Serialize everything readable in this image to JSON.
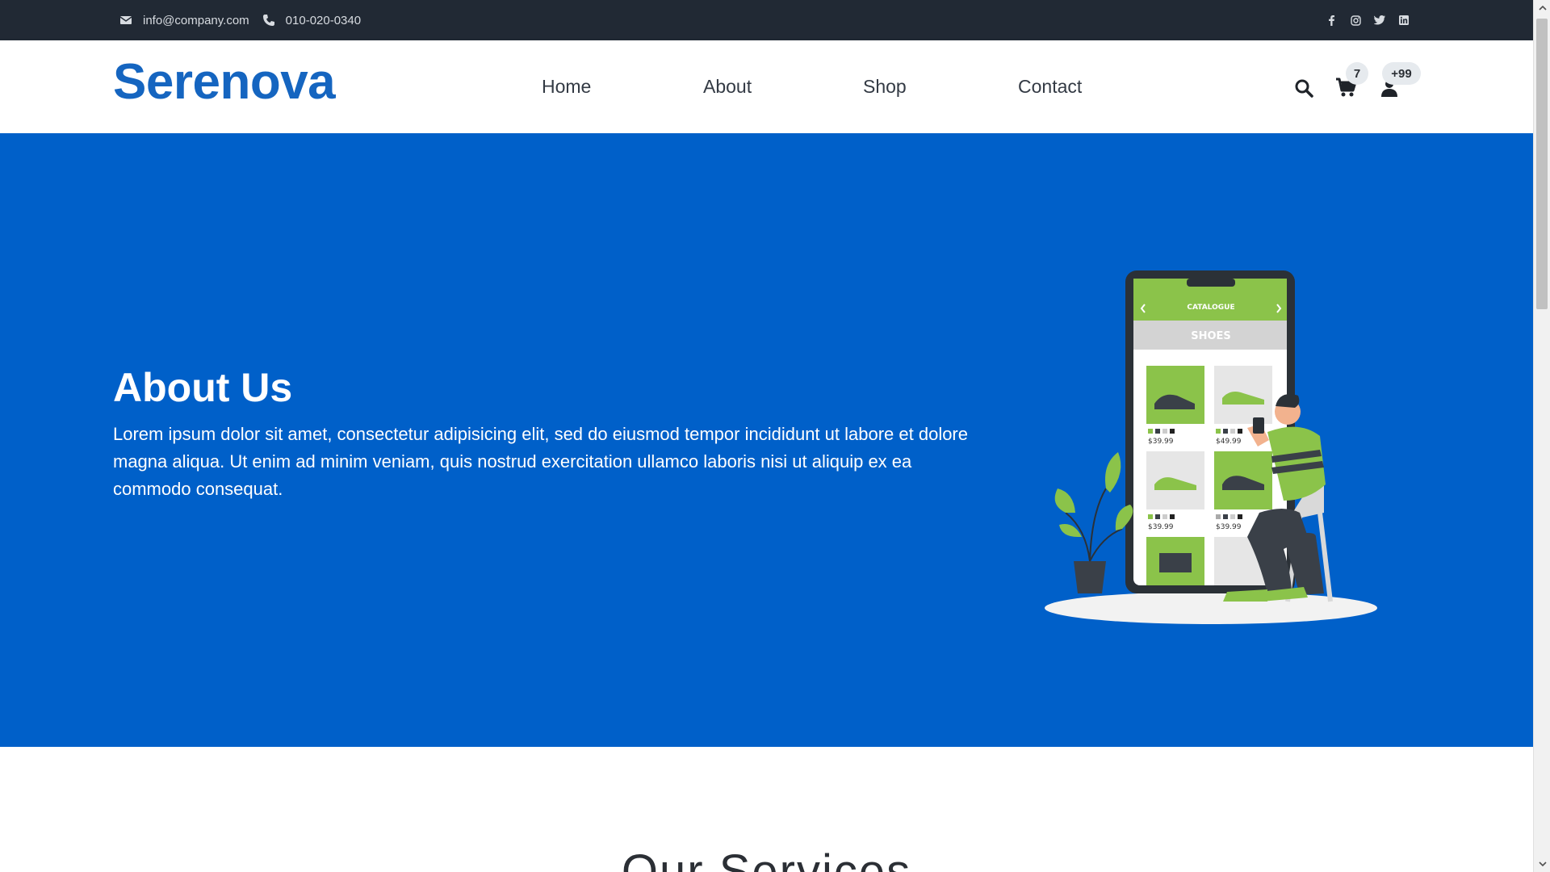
{
  "topbar": {
    "email": "info@company.com",
    "phone": "010-020-0340",
    "social": [
      "facebook-icon",
      "instagram-icon",
      "twitter-icon",
      "linkedin-icon"
    ]
  },
  "navbar": {
    "logo": "Serenova",
    "links": [
      "Home",
      "About",
      "Shop",
      "Contact"
    ],
    "cart_count": "7",
    "user_count": "+99"
  },
  "hero": {
    "title": "About Us",
    "text": "Lorem ipsum dolor sit amet, consectetur adipisicing elit, sed do eiusmod tempor incididunt ut labore et dolore magna aliqua. Ut enim ad minim veniam, quis nostrud exercitation ullamco laboris nisi ut aliquip ex ea commodo consequat.",
    "illustration": {
      "header": "CATALOGUE",
      "category": "SHOES",
      "prices": [
        "$39.99",
        "$49.99",
        "$39.99",
        "$39.99"
      ]
    }
  },
  "services": {
    "title": "Our Services"
  },
  "colors": {
    "brand": "#1565c0",
    "hero_bg": "#0060c9",
    "topbar_bg": "#212934",
    "accent_green": "#8bc34a"
  }
}
